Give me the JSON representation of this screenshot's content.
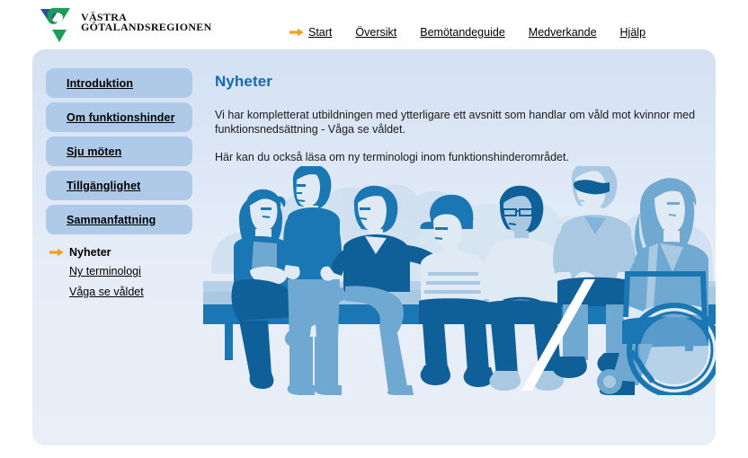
{
  "header": {
    "logo": {
      "line1": "VÄSTRA",
      "line2": "GÖTALANDSREGIONEN",
      "mark_blue": "#2c4b9b",
      "mark_green": "#1c9d57"
    },
    "nav": {
      "active_arrow_icon": "arrow-right-icon",
      "accent": "#f5a01e",
      "items": [
        {
          "label": "Start",
          "active": true
        },
        {
          "label": "Översikt",
          "active": false
        },
        {
          "label": "Bemötandeguide",
          "active": false
        },
        {
          "label": "Medverkande",
          "active": false
        },
        {
          "label": "Hjälp",
          "active": false
        }
      ]
    }
  },
  "sidebar": {
    "boxes": [
      {
        "label": "Introduktion"
      },
      {
        "label": "Om funktionshinder"
      },
      {
        "label": "Sju möten"
      },
      {
        "label": "Tillgänglighet"
      },
      {
        "label": "Sammanfattning"
      }
    ],
    "current": {
      "arrow_icon": "arrow-right-icon",
      "label": "Nyheter"
    },
    "sublinks": [
      {
        "label": "Ny terminologi"
      },
      {
        "label": "Våga se våldet"
      }
    ],
    "box_color": "#aecae8"
  },
  "main": {
    "title": "Nyheter",
    "paragraphs": [
      "Vi har kompletterat utbildningen med ytterligare ett avsnitt som handlar om våld mot kvinnor med funktionsnedsättning - Våga se våldet.",
      "Här kan du också läsa om ny terminologi inom funktionshinderområdet."
    ],
    "title_color": "#1669b4"
  },
  "illustration": {
    "alt": "Illustration av personer som sitter på en bänk, en person med vit käpp och en kvinna i rullstol",
    "palette": {
      "bg_cloud": "#cfe0f0",
      "bg_cloud_light": "#dce9f5",
      "light": "#dfeaf4",
      "mid_light": "#a9c9e3",
      "mid": "#6fa8d0",
      "dark": "#1a77b4",
      "darker": "#0f5f98"
    }
  },
  "panel": {
    "bg_top": "#d3e1f2",
    "bg_bottom": "#e9eff7"
  }
}
